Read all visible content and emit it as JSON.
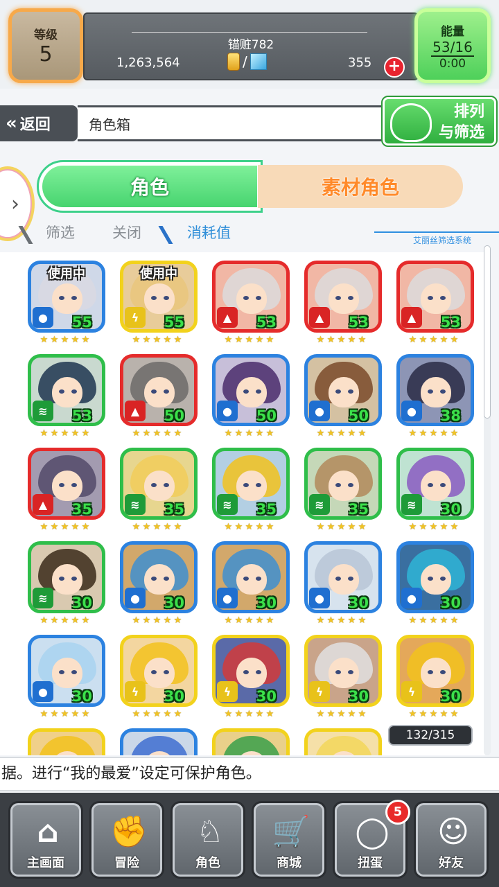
{
  "status": {
    "level_label": "等级",
    "level_value": "5",
    "player_name": "锚赃782",
    "gold": "1,263,564",
    "currency_separator": "/",
    "gems": "355",
    "add_symbol": "+",
    "energy_label": "能量",
    "energy_value": "53/16",
    "energy_timer": "0:00"
  },
  "nav": {
    "back_label": "返回",
    "back_arrows": "«",
    "title": "角色箱",
    "sort_line1": "排列",
    "sort_line2": "与筛选"
  },
  "tabs": {
    "chara": "角色",
    "material": "素材角色"
  },
  "filter": {
    "filter_label": "筛选",
    "filter_state": "关闭",
    "sort_by": "消耗值",
    "system_label": "艾丽丝筛选系统"
  },
  "grid": {
    "in_use_label": "使用中",
    "count": "132/315",
    "cards": [
      {
        "level": "55",
        "frame": "#2c82e0",
        "element": "water",
        "element_color": "#1f6fd0",
        "in_use": true,
        "bg": "#cfd8e8",
        "hair": "#d9d9e2",
        "rarity": 5
      },
      {
        "level": "55",
        "frame": "#f2d21c",
        "element": "thunder",
        "element_color": "#e8c21a",
        "in_use": true,
        "bg": "#e8cc9a",
        "hair": "#e9c57d",
        "rarity": 5
      },
      {
        "level": "53",
        "frame": "#e52b2b",
        "element": "fire",
        "element_color": "#d92424",
        "in_use": false,
        "bg": "#f1b7a5",
        "hair": "#dcdcdc",
        "rarity": 5
      },
      {
        "level": "53",
        "frame": "#e52b2b",
        "element": "fire",
        "element_color": "#d92424",
        "in_use": false,
        "bg": "#f1b7a5",
        "hair": "#dcdcdc",
        "rarity": 5
      },
      {
        "level": "53",
        "frame": "#e52b2b",
        "element": "fire",
        "element_color": "#d92424",
        "in_use": false,
        "bg": "#f1b7a5",
        "hair": "#dcdcdc",
        "rarity": 5
      },
      {
        "level": "53",
        "frame": "#2fbe4a",
        "element": "wind",
        "element_color": "#1e9b38",
        "in_use": false,
        "bg": "#c9d9cf",
        "hair": "#1f3550",
        "rarity": 5
      },
      {
        "level": "50",
        "frame": "#e52b2b",
        "element": "fire",
        "element_color": "#d92424",
        "in_use": false,
        "bg": "#b9b2ac",
        "hair": "#6c6a68",
        "rarity": 5
      },
      {
        "level": "50",
        "frame": "#2c82e0",
        "element": "water",
        "element_color": "#1f6fd0",
        "in_use": false,
        "bg": "#c7bfd9",
        "hair": "#4a2c6b",
        "rarity": 5
      },
      {
        "level": "50",
        "frame": "#2c82e0",
        "element": "water",
        "element_color": "#1f6fd0",
        "in_use": false,
        "bg": "#d4c1a2",
        "hair": "#7a4a2a",
        "rarity": 5
      },
      {
        "level": "38",
        "frame": "#2c82e0",
        "element": "water",
        "element_color": "#1f6fd0",
        "in_use": false,
        "bg": "#8d95b5",
        "hair": "#2a2c45",
        "rarity": 5
      },
      {
        "level": "35",
        "frame": "#e52b2b",
        "element": "fire",
        "element_color": "#d92424",
        "in_use": false,
        "bg": "#a39bb0",
        "hair": "#544a6a",
        "rarity": 5
      },
      {
        "level": "35",
        "frame": "#2fbe4a",
        "element": "wind",
        "element_color": "#1e9b38",
        "in_use": false,
        "bg": "#e7d68f",
        "hair": "#f1cc5a",
        "rarity": 5
      },
      {
        "level": "35",
        "frame": "#2fbe4a",
        "element": "wind",
        "element_color": "#1e9b38",
        "in_use": false,
        "bg": "#b3cfe3",
        "hair": "#f2c21d",
        "rarity": 5
      },
      {
        "level": "35",
        "frame": "#2fbe4a",
        "element": "wind",
        "element_color": "#1e9b38",
        "in_use": false,
        "bg": "#c5d8b8",
        "hair": "#b28a5a",
        "rarity": 5
      },
      {
        "level": "30",
        "frame": "#2fbe4a",
        "element": "wind",
        "element_color": "#1e9b38",
        "in_use": false,
        "bg": "#bfe3d2",
        "hair": "#8a5ac2",
        "rarity": 5
      },
      {
        "level": "30",
        "frame": "#2fbe4a",
        "element": "wind",
        "element_color": "#1e9b38",
        "in_use": false,
        "bg": "#d9c9b0",
        "hair": "#3a2a1a",
        "rarity": 5
      },
      {
        "level": "30",
        "frame": "#2c82e0",
        "element": "water",
        "element_color": "#1f6fd0",
        "in_use": false,
        "bg": "#d2a86b",
        "hair": "#3f8fd0",
        "rarity": 5
      },
      {
        "level": "30",
        "frame": "#2c82e0",
        "element": "water",
        "element_color": "#1f6fd0",
        "in_use": false,
        "bg": "#d2a86b",
        "hair": "#3f8fd0",
        "rarity": 5
      },
      {
        "level": "30",
        "frame": "#2c82e0",
        "element": "water",
        "element_color": "#1f6fd0",
        "in_use": false,
        "bg": "#d7e3ee",
        "hair": "#b8c6d6",
        "rarity": 5
      },
      {
        "level": "30",
        "frame": "#2c82e0",
        "element": "water",
        "element_color": "#1f6fd0",
        "in_use": false,
        "bg": "#3a6fa0",
        "hair": "#2fb5d6",
        "rarity": 5
      },
      {
        "level": "30",
        "frame": "#2c82e0",
        "element": "water",
        "element_color": "#1f6fd0",
        "in_use": false,
        "bg": "#cbdff0",
        "hair": "#a9d3f0",
        "rarity": 5
      },
      {
        "level": "30",
        "frame": "#f2d21c",
        "element": "thunder",
        "element_color": "#e8c21a",
        "in_use": false,
        "bg": "#f3d6a0",
        "hair": "#f2c21d",
        "rarity": 5
      },
      {
        "level": "30",
        "frame": "#f2d21c",
        "element": "thunder",
        "element_color": "#e8c21a",
        "in_use": false,
        "bg": "#5a6aa8",
        "hair": "#d23a3a",
        "rarity": 5
      },
      {
        "level": "30",
        "frame": "#f2d21c",
        "element": "thunder",
        "element_color": "#e8c21a",
        "in_use": false,
        "bg": "#c9a48a",
        "hair": "#e0e0e0",
        "rarity": 5
      },
      {
        "level": "30",
        "frame": "#f2d21c",
        "element": "thunder",
        "element_color": "#e8c21a",
        "in_use": false,
        "bg": "#e4a85a",
        "hair": "#f2c21d",
        "rarity": 5
      },
      {
        "level": "",
        "frame": "#f2d21c",
        "element": "thunder",
        "element_color": "#e8c21a",
        "in_use": false,
        "bg": "#f0d08a",
        "hair": "#f2c21d",
        "rarity": 0
      },
      {
        "level": "",
        "frame": "#2c82e0",
        "element": "water",
        "element_color": "#1f6fd0",
        "in_use": false,
        "bg": "#cbd8e8",
        "hair": "#3f6fd0",
        "rarity": 0
      },
      {
        "level": "",
        "frame": "#f2d21c",
        "element": "thunder",
        "element_color": "#e8c21a",
        "in_use": false,
        "bg": "#e9d08a",
        "hair": "#3aa04a",
        "rarity": 0
      },
      {
        "level": "",
        "frame": "#f2d21c",
        "element": "thunder",
        "element_color": "#e8c21a",
        "in_use": false,
        "bg": "#f5e0a8",
        "hair": "#f2d65a",
        "rarity": 0
      }
    ]
  },
  "ticker": "据。进行“我的最爱”设定可保护角色。",
  "bottom_nav": [
    {
      "label": "主画面",
      "icon": "home-icon"
    },
    {
      "label": "冒险",
      "icon": "handshake-icon"
    },
    {
      "label": "角色",
      "icon": "rabbit-icon"
    },
    {
      "label": "商城",
      "icon": "cart-icon"
    },
    {
      "label": "扭蛋",
      "icon": "egg-icon"
    },
    {
      "label": "好友",
      "icon": "friends-icon"
    }
  ],
  "gacha_badge": "5"
}
